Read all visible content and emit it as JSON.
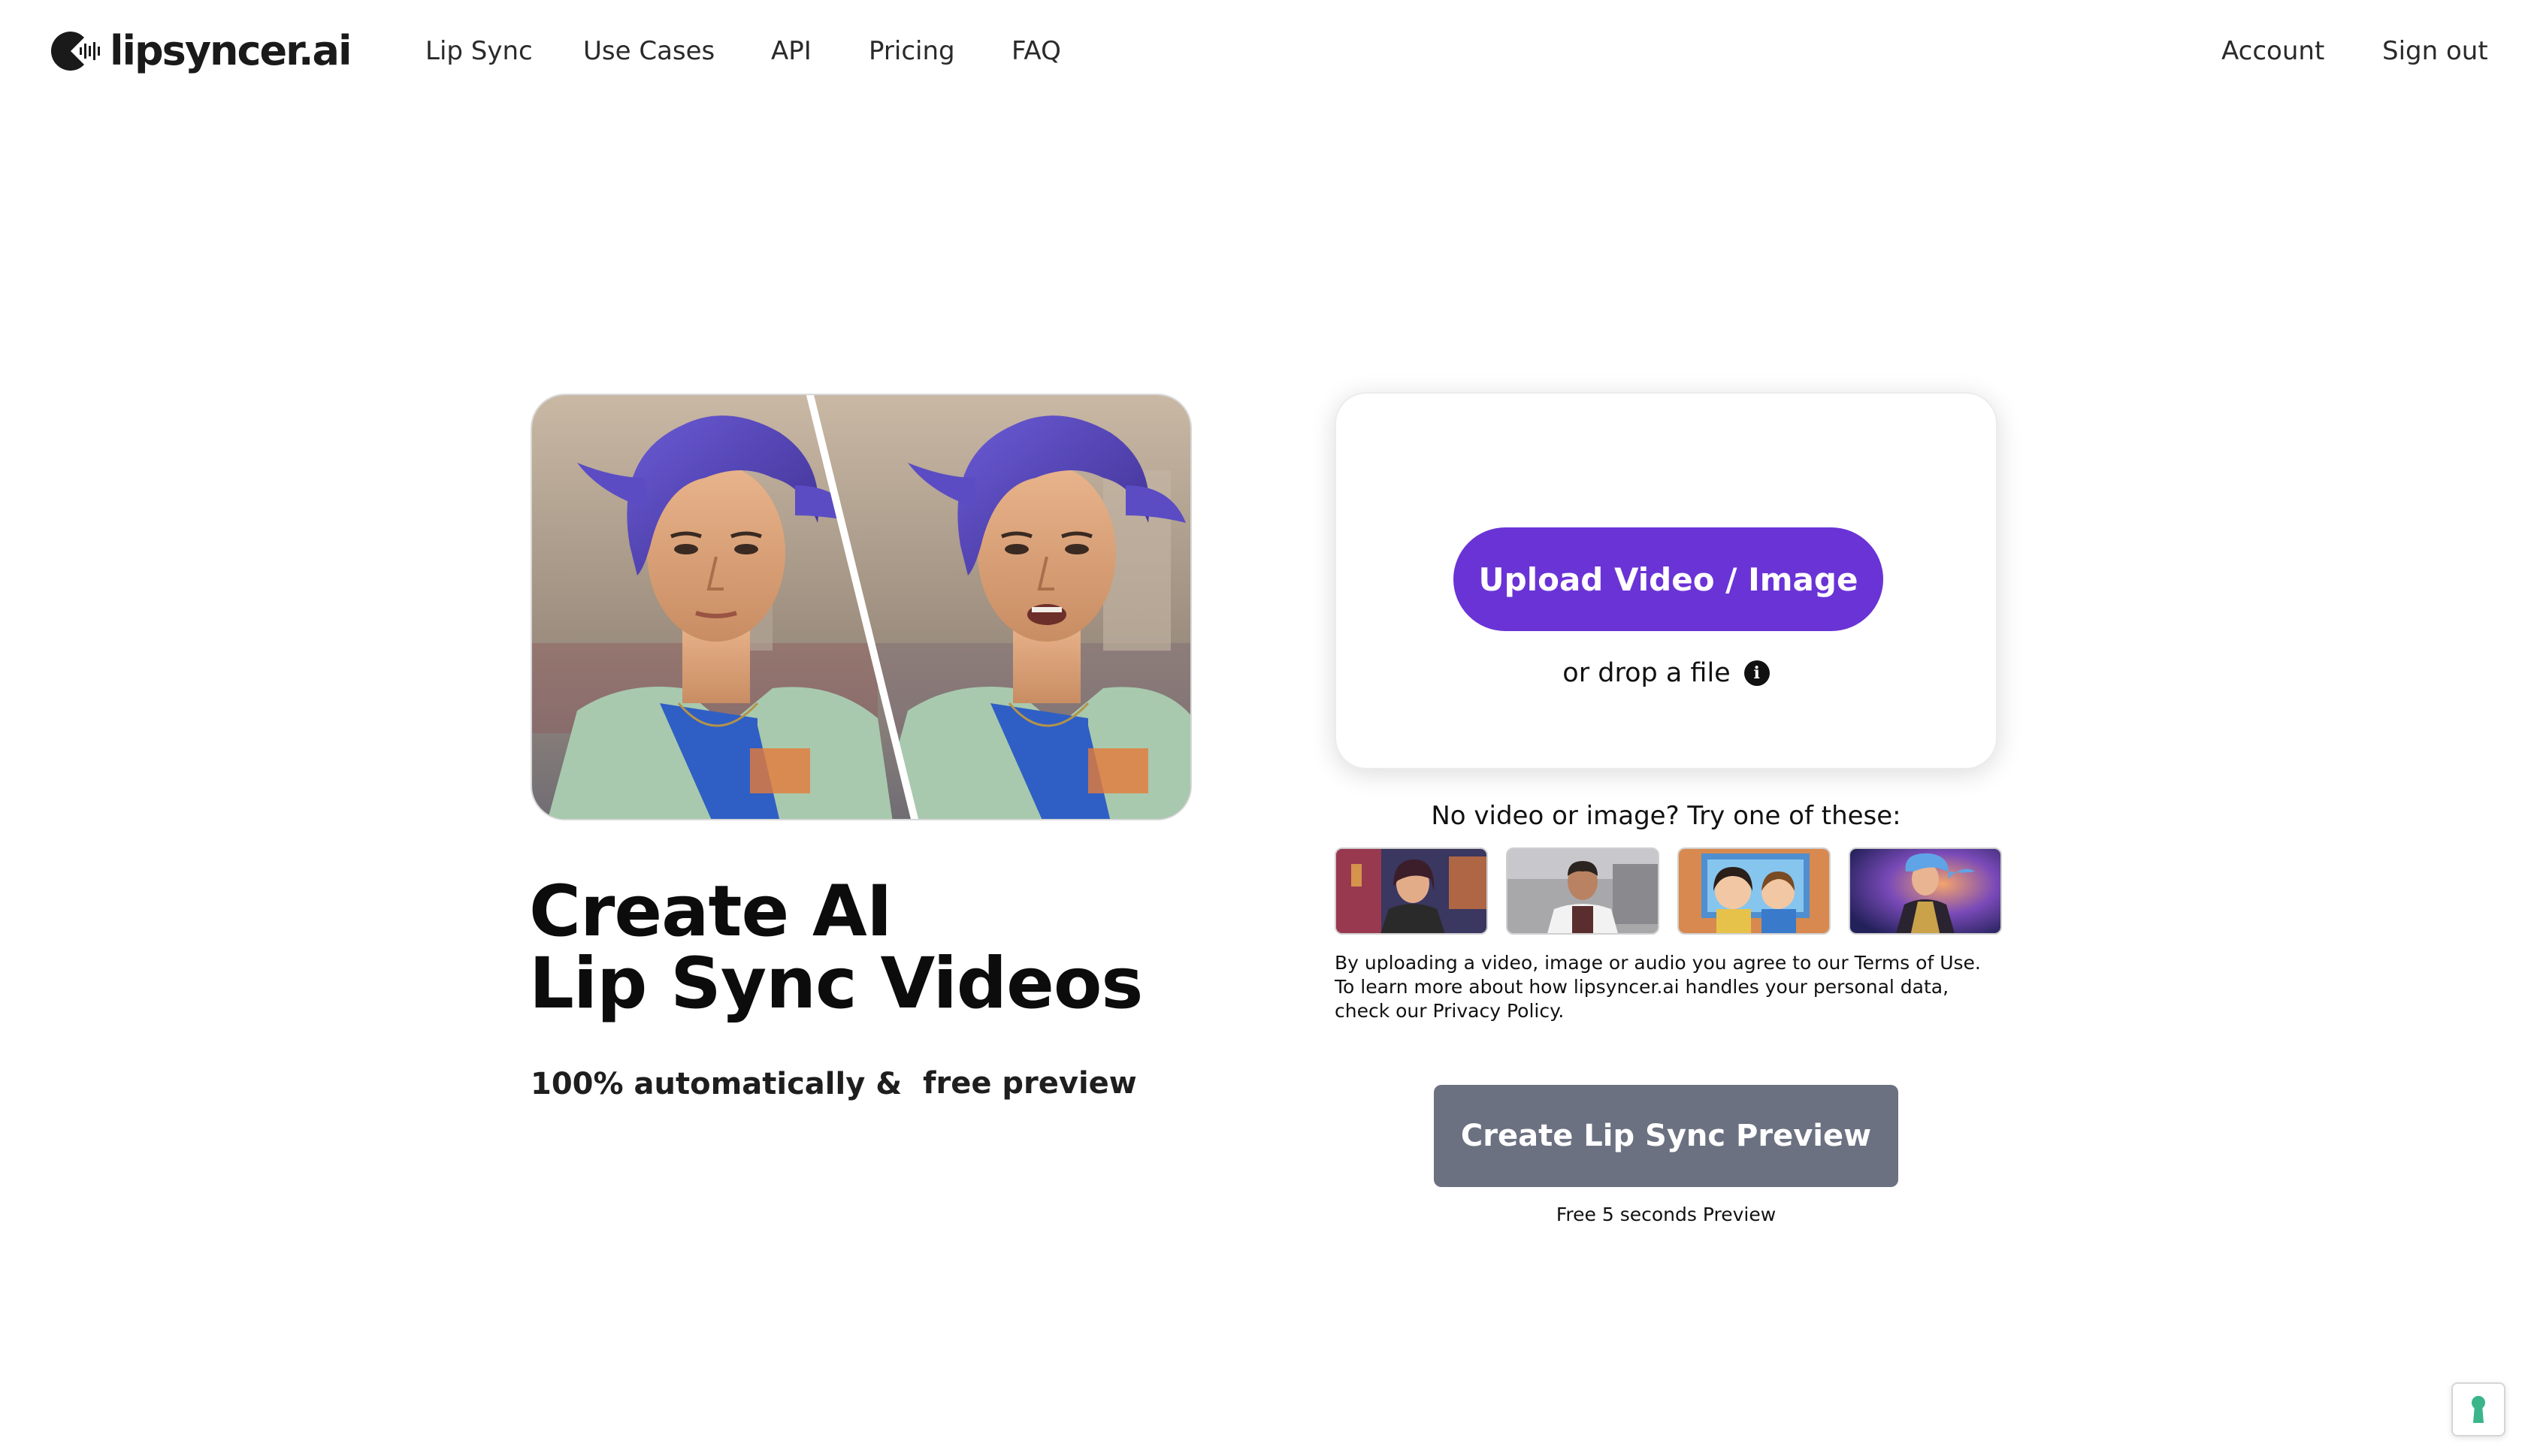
{
  "brand": {
    "name": "lipsyncer.ai",
    "accent": "#6a33d6"
  },
  "nav": {
    "items": [
      {
        "label": "Lip Sync"
      },
      {
        "label": "Use Cases"
      },
      {
        "label": "API"
      },
      {
        "label": "Pricing"
      },
      {
        "label": "FAQ"
      }
    ],
    "account": "Account",
    "sign_out": "Sign out"
  },
  "hero": {
    "headline_line1": "Create AI",
    "headline_line2": "Lip Sync Videos",
    "sub_text": "100% automatically &",
    "highlight_text": "free preview",
    "highlight_color": "#f2f93a"
  },
  "upload": {
    "button_label": "Upload Video / Image",
    "drop_text": "or drop a file",
    "info_icon": "info-icon"
  },
  "samples": {
    "title": "No video or image? Try one of these:",
    "items": [
      {
        "icon": "sample-thumbnail-woman-city"
      },
      {
        "icon": "sample-thumbnail-chef"
      },
      {
        "icon": "sample-thumbnail-cartoon-kids"
      },
      {
        "icon": "sample-thumbnail-fantasy-warrior"
      }
    ]
  },
  "legal": {
    "before_terms": "By uploading a video, image or audio you agree to our ",
    "terms_link": "Terms of Use",
    "middle": ". To learn more about how lipsyncer.ai handles your personal data, check our ",
    "privacy_link": "Privacy Policy",
    "after": "."
  },
  "create": {
    "button_label": "Create Lip Sync Preview",
    "button_color": "#6b7180",
    "note": "Free 5 seconds Preview"
  }
}
